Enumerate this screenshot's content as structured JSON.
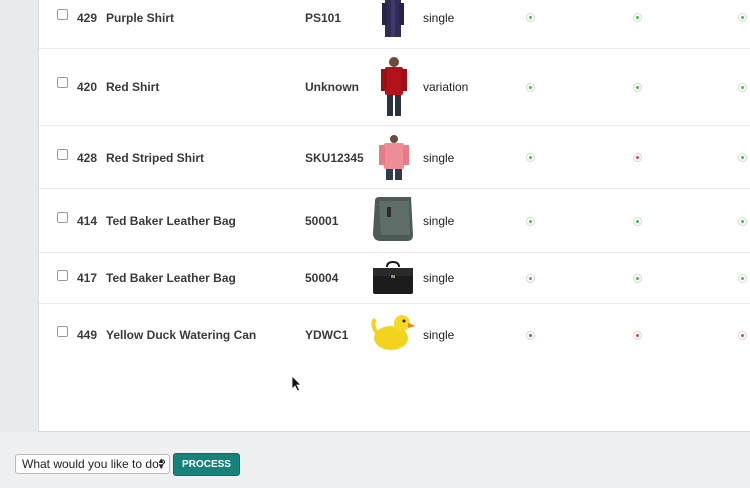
{
  "rows": [
    {
      "id": "429",
      "name": "Purple Shirt",
      "sku": "PS101",
      "type": "single",
      "status": [
        "green",
        "green",
        "green"
      ]
    },
    {
      "id": "420",
      "name": "Red Shirt",
      "sku": "Unknown",
      "type": "variation",
      "status": [
        "green",
        "green",
        "green"
      ]
    },
    {
      "id": "428",
      "name": "Red Striped Shirt",
      "sku": "SKU12345",
      "type": "single",
      "status": [
        "green",
        "red",
        "green"
      ]
    },
    {
      "id": "414",
      "name": "Ted Baker Leather Bag",
      "sku": "50001",
      "type": "single",
      "status": [
        "green",
        "green",
        "green"
      ]
    },
    {
      "id": "417",
      "name": "Ted Baker Leather Bag",
      "sku": "50004",
      "type": "single",
      "status": [
        "green",
        "green",
        "green"
      ]
    },
    {
      "id": "449",
      "name": "Yellow Duck Watering Can",
      "sku": "YDWC1",
      "type": "single",
      "status": [
        "red",
        "red",
        "red"
      ]
    }
  ],
  "status_colors": {
    "green": "#3cc43c",
    "red": "#d94848"
  },
  "bulk_action": {
    "selected": "What would you like to do?"
  },
  "process_label": "PROCESS"
}
